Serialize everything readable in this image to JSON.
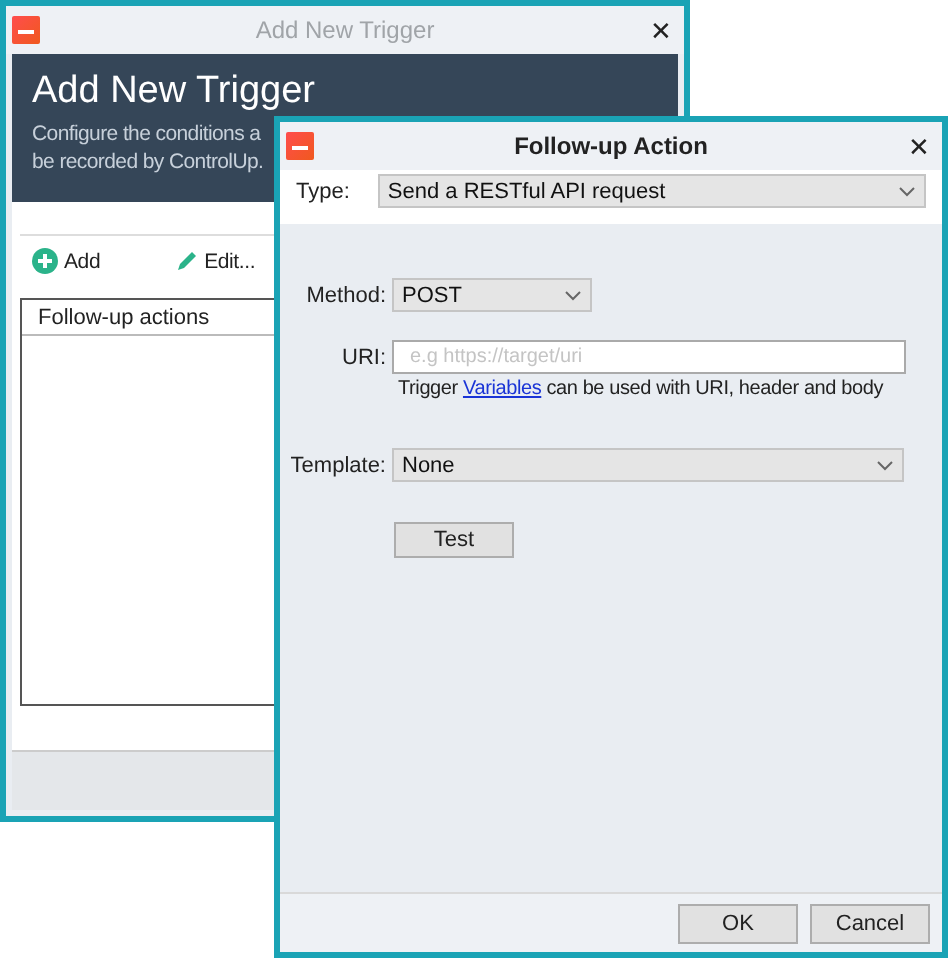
{
  "trigger_window": {
    "title": "Add New Trigger",
    "close": "✕",
    "heading": "Add New Trigger",
    "description_lines": [
      "Configure the conditions a",
      "be recorded by ControlUp."
    ],
    "toolbar": [
      {
        "kind": "add",
        "label": "Add"
      },
      {
        "kind": "edit",
        "label": "Edit..."
      }
    ],
    "list": {
      "column": "Follow-up actions"
    }
  },
  "action_window": {
    "title": "Follow-up Action",
    "close": "✕",
    "type": {
      "label": "Type:",
      "value": "Send a RESTful API request"
    },
    "method": {
      "label": "Method:",
      "value": "POST"
    },
    "uri": {
      "label": "URI:",
      "placeholder": "e.g https://target/uri"
    },
    "hint": {
      "before": "Trigger ",
      "link": "Variables",
      "after": " can be used with URI, header and body"
    },
    "template": {
      "label": "Template:",
      "value": "None"
    },
    "test_button": "Test",
    "buttons": [
      "OK",
      "Cancel"
    ]
  }
}
